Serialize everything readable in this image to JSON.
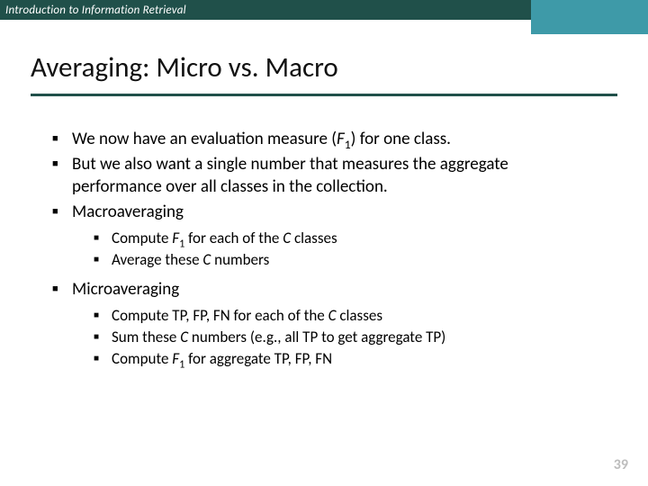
{
  "header": {
    "course": "Introduction to Information Retrieval"
  },
  "title": "Averaging: Micro vs. Macro",
  "bullets": {
    "b1_pre": "We now have an evaluation measure (",
    "b1_F": "F",
    "b1_sub": "1",
    "b1_post": ") for one class.",
    "b2": "But we also want a single number that measures the aggregate performance over all classes in the collection.",
    "b3": "Macroaveraging",
    "b3a_pre": "Compute ",
    "b3a_F": "F",
    "b3a_sub": "1",
    "b3a_mid": " for each of the ",
    "b3a_C": "C",
    "b3a_post": " classes",
    "b3b_pre": "Average these ",
    "b3b_C": "C",
    "b3b_post": " numbers",
    "b4": "Microaveraging",
    "b4a_pre": "Compute TP, FP, FN for each of the ",
    "b4a_C": "C",
    "b4a_post": " classes",
    "b4b_pre": "Sum these ",
    "b4b_C": "C",
    "b4b_post": " numbers (e.g., all TP to get aggregate TP)",
    "b4c_pre": "Compute ",
    "b4c_F": "F",
    "b4c_sub": "1",
    "b4c_post": " for aggregate TP, FP, FN"
  },
  "page_number": "39"
}
